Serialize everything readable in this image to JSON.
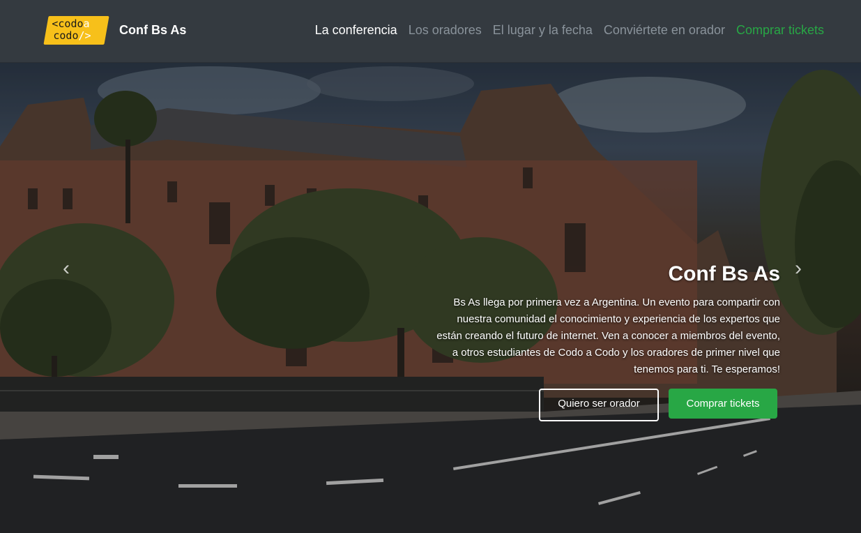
{
  "header": {
    "logo": {
      "line1_a": "<codo",
      "line1_b": "a",
      "line2_a": "codo",
      "line2_b": "/>"
    },
    "brand": "Conf Bs As",
    "nav": [
      {
        "label": "La conferencia",
        "state": "active"
      },
      {
        "label": "Los oradores",
        "state": "default"
      },
      {
        "label": "El lugar y la fecha",
        "state": "default"
      },
      {
        "label": "Conviértete en orador",
        "state": "default"
      },
      {
        "label": "Comprar tickets",
        "state": "highlight"
      }
    ]
  },
  "hero": {
    "title": "Conf Bs As",
    "text": "Bs As llega por primera vez a Argentina. Un evento para compartir con nuestra comunidad el conocimiento y experiencia de los expertos que están creando el futuro de internet. Ven a conocer a miembros del evento, a otros estudiantes de Codo a Codo y los oradores de primer nivel que tenemos para ti. Te esperamos!",
    "buttons": {
      "speaker": "Quiero ser orador",
      "tickets": "Comprar tickets"
    },
    "prev_icon": "chevron-left-icon",
    "next_icon": "chevron-right-icon"
  },
  "colors": {
    "navbar": "#343a40",
    "success": "#28a745",
    "logo": "#f7c01a",
    "nav_muted": "#8a939b"
  }
}
